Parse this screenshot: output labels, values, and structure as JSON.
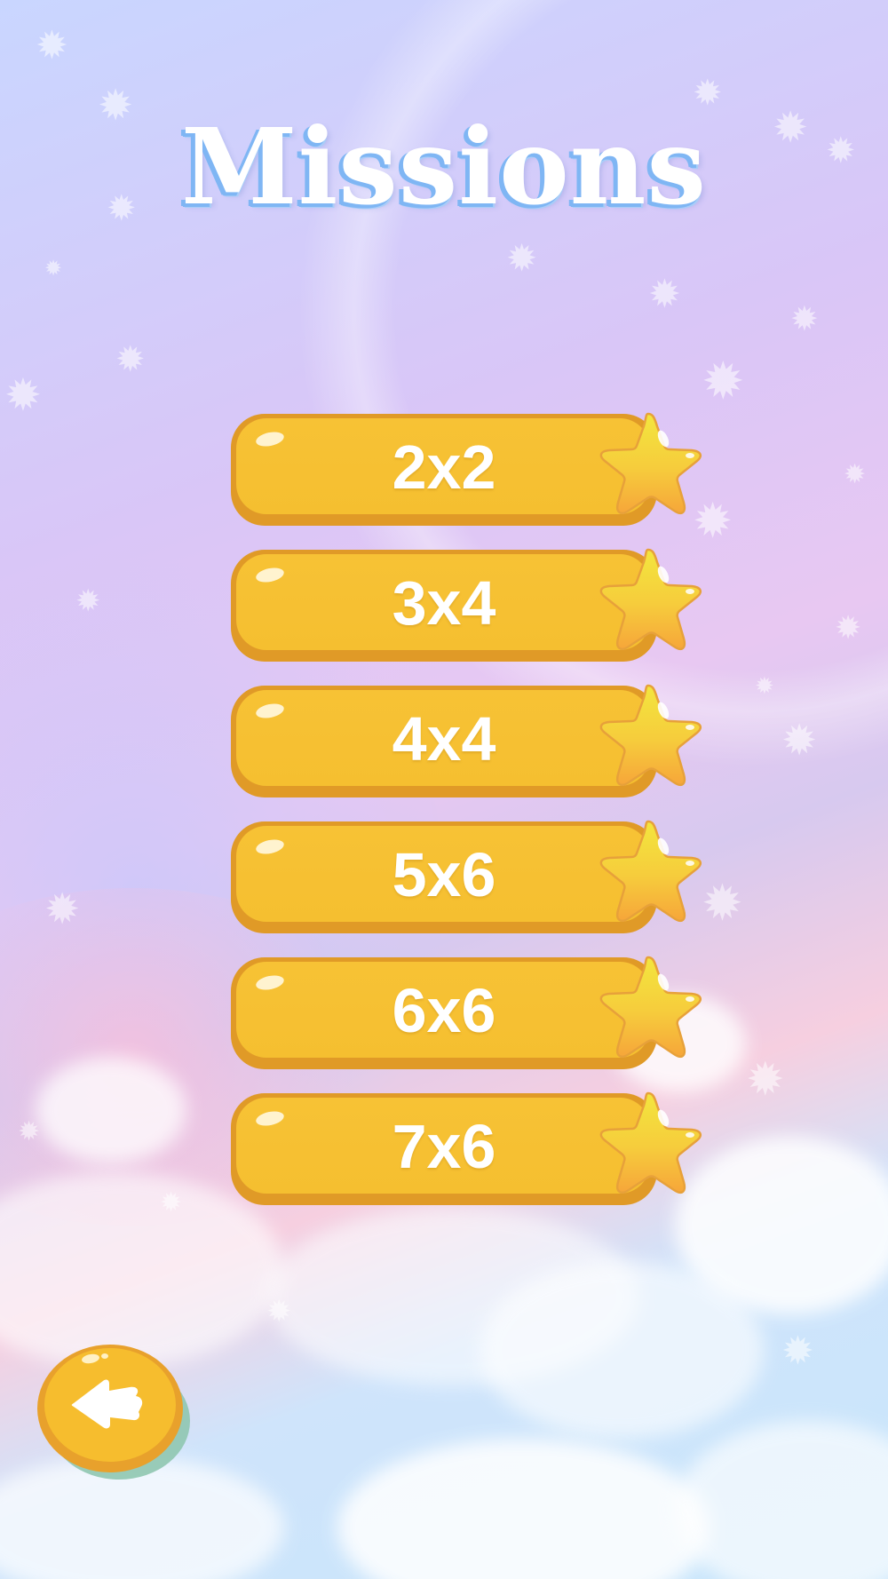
{
  "screen": {
    "title": "Missions"
  },
  "missions": [
    {
      "label": "2x2",
      "icon": "star-icon"
    },
    {
      "label": "3x4",
      "icon": "star-icon"
    },
    {
      "label": "4x4",
      "icon": "star-icon"
    },
    {
      "label": "5x6",
      "icon": "star-icon"
    },
    {
      "label": "6x6",
      "icon": "star-icon"
    },
    {
      "label": "7x6",
      "icon": "star-icon"
    }
  ],
  "back_button": {
    "icon": "back-arrow-icon"
  },
  "colors": {
    "button_fill": "#f6c032",
    "button_border": "#e09a27",
    "title_shadow": "#7fb6f4",
    "star_top": "#f3e23c",
    "star_bottom": "#f6aa3a"
  }
}
